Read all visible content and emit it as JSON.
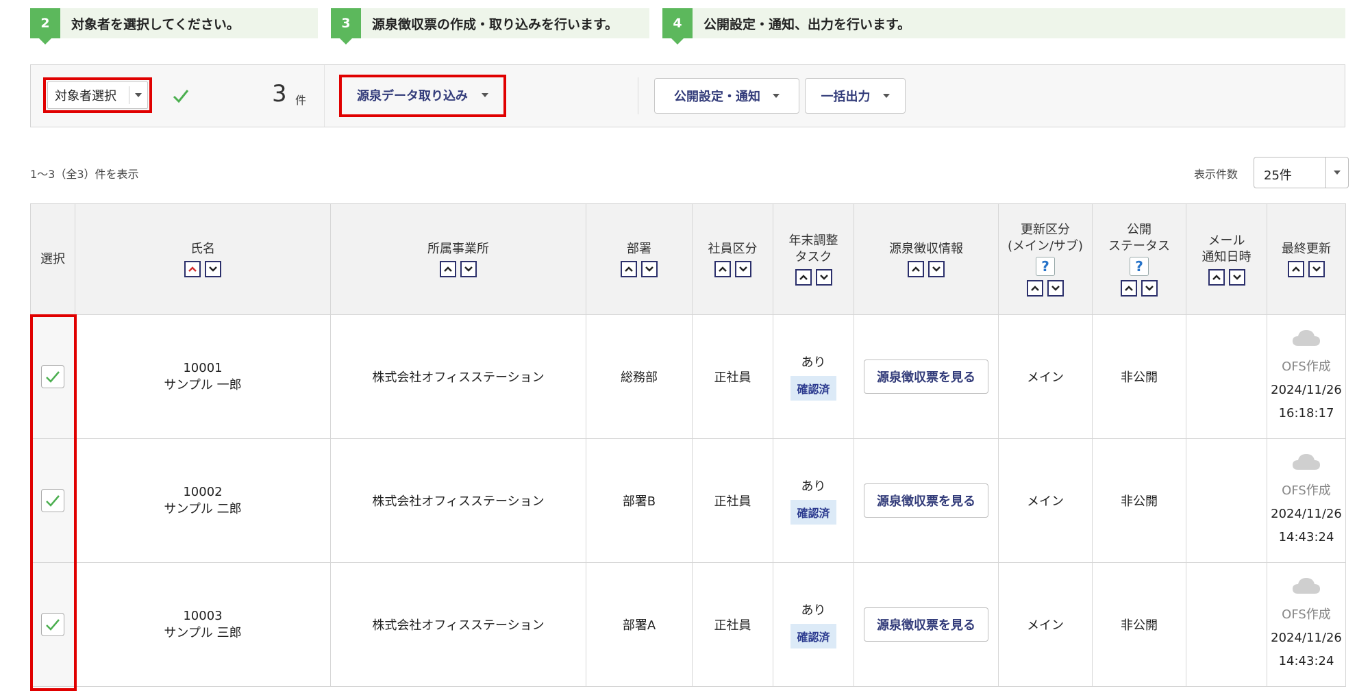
{
  "steps": [
    {
      "num": "2",
      "text": "対象者を選択してください。"
    },
    {
      "num": "3",
      "text": "源泉徴収票の作成・取り込みを行います。"
    },
    {
      "num": "4",
      "text": "公開設定・通知、出力を行います。"
    }
  ],
  "toolbar": {
    "target_select": "対象者選択",
    "count": "3",
    "count_unit": "件",
    "import_label": "源泉データ取り込み",
    "publish_label": "公開設定・通知",
    "bulk_output_label": "一括出力"
  },
  "list": {
    "count_info": "1～3（全3）件を表示",
    "per_page_label": "表示件数",
    "per_page_value": "25件"
  },
  "table": {
    "headers": {
      "select": "選択",
      "name": "氏名",
      "office": "所属事業所",
      "dept": "部署",
      "emp_type": "社員区分",
      "yearend_1": "年末調整",
      "yearend_2": "タスク",
      "withholding": "源泉徴収情報",
      "update_1": "更新区分",
      "update_2": "(メイン/サブ)",
      "status_1": "公開",
      "status_2": "ステータス",
      "mail_1": "メール",
      "mail_2": "通知日時",
      "last_update": "最終更新"
    },
    "help_mark": "?",
    "rows": [
      {
        "id": "10001",
        "name": "サンプル 一郎",
        "office": "株式会社オフィスステーション",
        "dept": "総務部",
        "emp_type": "正社員",
        "task": "あり",
        "task_badge": "確認済",
        "view_btn": "源泉徴収票を見る",
        "update_type": "メイン",
        "status": "非公開",
        "mail": "",
        "created_by": "OFS作成",
        "date": "2024/11/26",
        "time": "16:18:17"
      },
      {
        "id": "10002",
        "name": "サンプル 二郎",
        "office": "株式会社オフィスステーション",
        "dept": "部署B",
        "emp_type": "正社員",
        "task": "あり",
        "task_badge": "確認済",
        "view_btn": "源泉徴収票を見る",
        "update_type": "メイン",
        "status": "非公開",
        "mail": "",
        "created_by": "OFS作成",
        "date": "2024/11/26",
        "time": "14:43:24"
      },
      {
        "id": "10003",
        "name": "サンプル 三郎",
        "office": "株式会社オフィスステーション",
        "dept": "部署A",
        "emp_type": "正社員",
        "task": "あり",
        "task_badge": "確認済",
        "view_btn": "源泉徴収票を見る",
        "update_type": "メイン",
        "status": "非公開",
        "mail": "",
        "created_by": "OFS作成",
        "date": "2024/11/26",
        "time": "14:43:24"
      }
    ]
  },
  "colors": {
    "step_green": "#5cb85c",
    "highlight_red": "#e00000",
    "link_navy": "#333c7a",
    "check_green": "#4caf50"
  }
}
